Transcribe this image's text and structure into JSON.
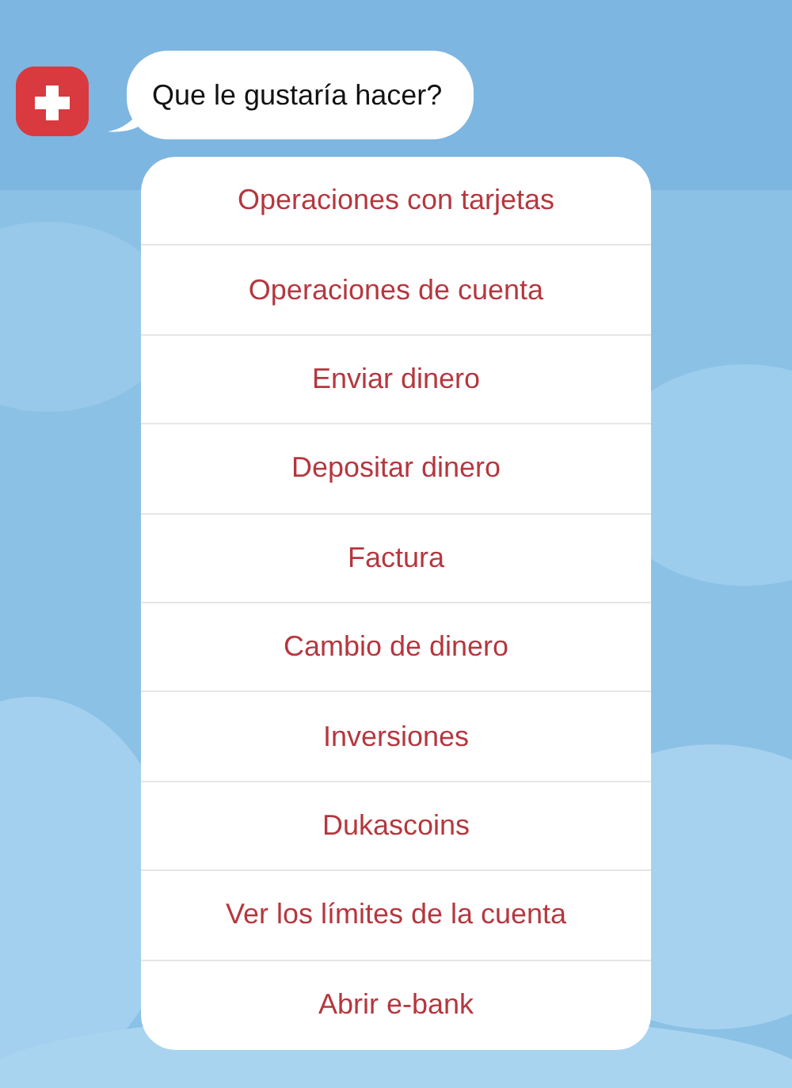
{
  "message": {
    "text": "Que le gustaría hacer?"
  },
  "options": [
    {
      "label": "Operaciones con tarjetas"
    },
    {
      "label": "Operaciones de cuenta"
    },
    {
      "label": "Enviar dinero"
    },
    {
      "label": "Depositar dinero"
    },
    {
      "label": "Factura"
    },
    {
      "label": "Cambio de dinero"
    },
    {
      "label": "Inversiones"
    },
    {
      "label": "Dukascoins"
    },
    {
      "label": "Ver los límites de la cuenta"
    },
    {
      "label": "Abrir e-bank"
    }
  ]
}
